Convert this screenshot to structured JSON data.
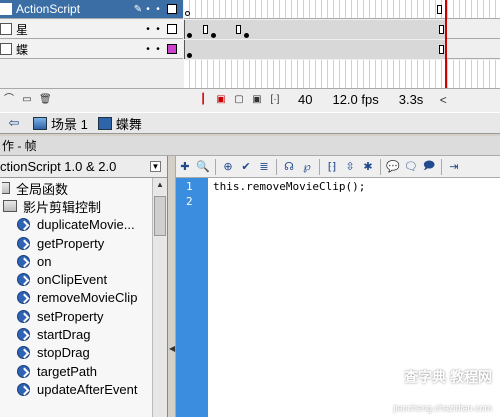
{
  "timeline": {
    "layers": [
      {
        "name": "ActionScript",
        "color": "#ffffff",
        "selected": true
      },
      {
        "name": "星",
        "color": "#ffffff",
        "selected": false
      },
      {
        "name": "蝶",
        "color": "#cc44cc",
        "selected": false
      }
    ],
    "status": {
      "current_frame": "40",
      "fps": "12.0 fps",
      "time": "3.3s"
    }
  },
  "scene_bar": {
    "scene": "场景 1",
    "symbol": "蝶舞"
  },
  "actions_panel": {
    "title": "作 - 帧"
  },
  "toolbox": {
    "header": "ctionScript 1.0 & 2.0",
    "categories": [
      {
        "label": "全局函数"
      },
      {
        "label": "影片剪辑控制"
      }
    ],
    "items": [
      "duplicateMovie...",
      "getProperty",
      "on",
      "onClipEvent",
      "removeMovieClip",
      "setProperty",
      "startDrag",
      "stopDrag",
      "targetPath",
      "updateAfterEvent"
    ]
  },
  "editor": {
    "line_numbers": [
      "1",
      "2"
    ],
    "code": "this.removeMovieClip();"
  },
  "watermark": {
    "text": "查字典 教程网",
    "site": "jiaocheng.chazidian.com"
  }
}
